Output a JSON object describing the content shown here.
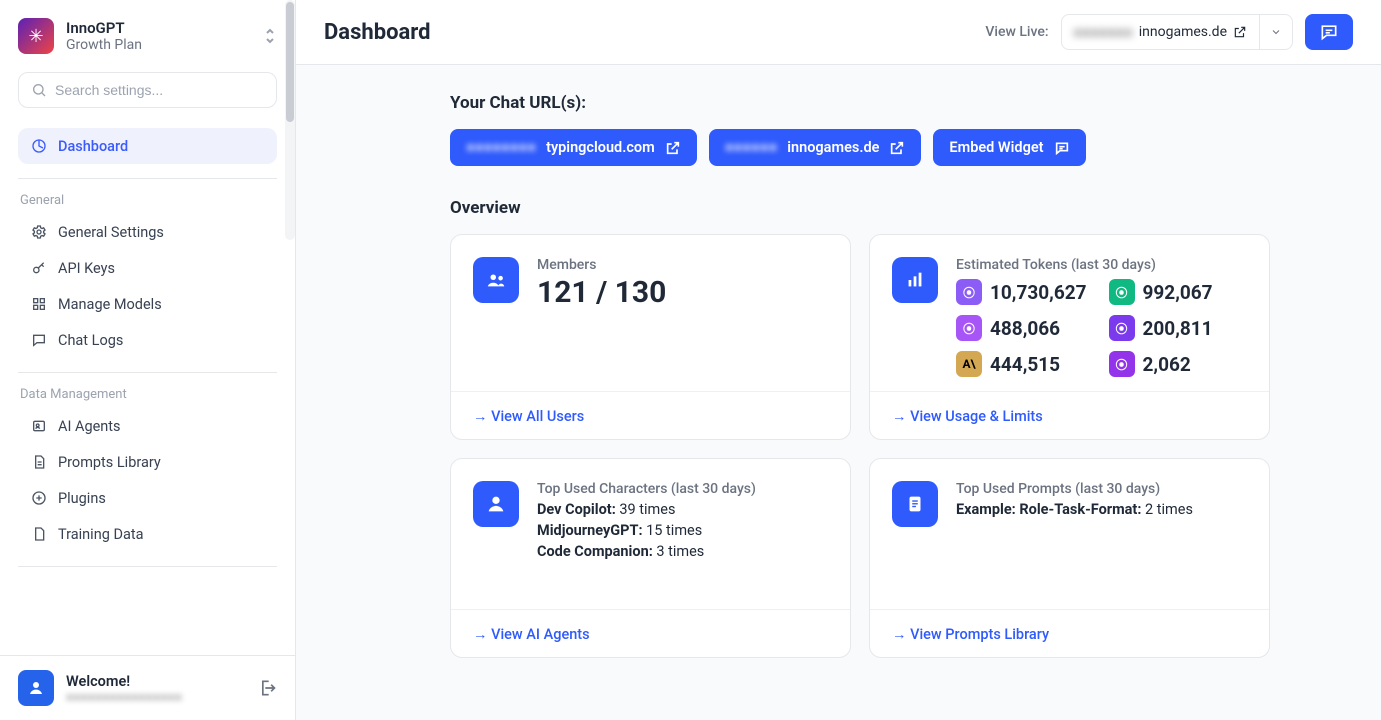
{
  "workspace": {
    "name": "InnoGPT",
    "plan": "Growth Plan"
  },
  "search": {
    "placeholder": "Search settings..."
  },
  "nav": {
    "dashboard": "Dashboard",
    "section_general": "General",
    "general_settings": "General Settings",
    "api_keys": "API Keys",
    "manage_models": "Manage Models",
    "chat_logs": "Chat Logs",
    "section_data": "Data Management",
    "ai_agents": "AI Agents",
    "prompts_library": "Prompts Library",
    "plugins": "Plugins",
    "training_data": "Training Data"
  },
  "footer": {
    "welcome": "Welcome!",
    "subtext": "■■■■■■■■■■■■■■■■"
  },
  "topbar": {
    "title": "Dashboard",
    "viewlive_label": "View Live:",
    "live_url_blur": "■■■■■■■",
    "live_url_suffix": "innogames.de"
  },
  "urls": {
    "section": "Your Chat URL(s):",
    "primary_blur": "■■■■■■■■",
    "primary_suffix": "typingcloud.com",
    "secondary_blur": "■■■■■■",
    "secondary_suffix": "innogames.de",
    "embed": "Embed Widget"
  },
  "overview": {
    "title": "Overview",
    "members": {
      "label": "Members",
      "value": "121 / 130",
      "link": "→ View All Users"
    },
    "tokens": {
      "label": "Estimated Tokens (last 30 days)",
      "items": [
        {
          "badge": "⦿",
          "cls": "tb-purple",
          "value": "10,730,627"
        },
        {
          "badge": "⦿",
          "cls": "tb-green",
          "value": "992,067"
        },
        {
          "badge": "⦿",
          "cls": "tb-pink",
          "value": "488,066"
        },
        {
          "badge": "⦿",
          "cls": "tb-violet",
          "value": "200,811"
        },
        {
          "badge": "A\\",
          "cls": "tb-gold",
          "value": "444,515"
        },
        {
          "badge": "⦿",
          "cls": "tb-lav",
          "value": "2,062"
        }
      ],
      "link": "→ View Usage & Limits"
    },
    "characters": {
      "label": "Top Used Characters (last 30 days)",
      "rows": [
        {
          "name": "Dev Copilot:",
          "count": "39 times"
        },
        {
          "name": "MidjourneyGPT:",
          "count": "15 times"
        },
        {
          "name": "Code Companion:",
          "count": "3 times"
        }
      ],
      "link": "→ View AI Agents"
    },
    "prompts": {
      "label": "Top Used Prompts (last 30 days)",
      "rows": [
        {
          "name": "Example: Role-Task-Format:",
          "count": "2 times"
        }
      ],
      "link": "→ View Prompts Library"
    }
  }
}
